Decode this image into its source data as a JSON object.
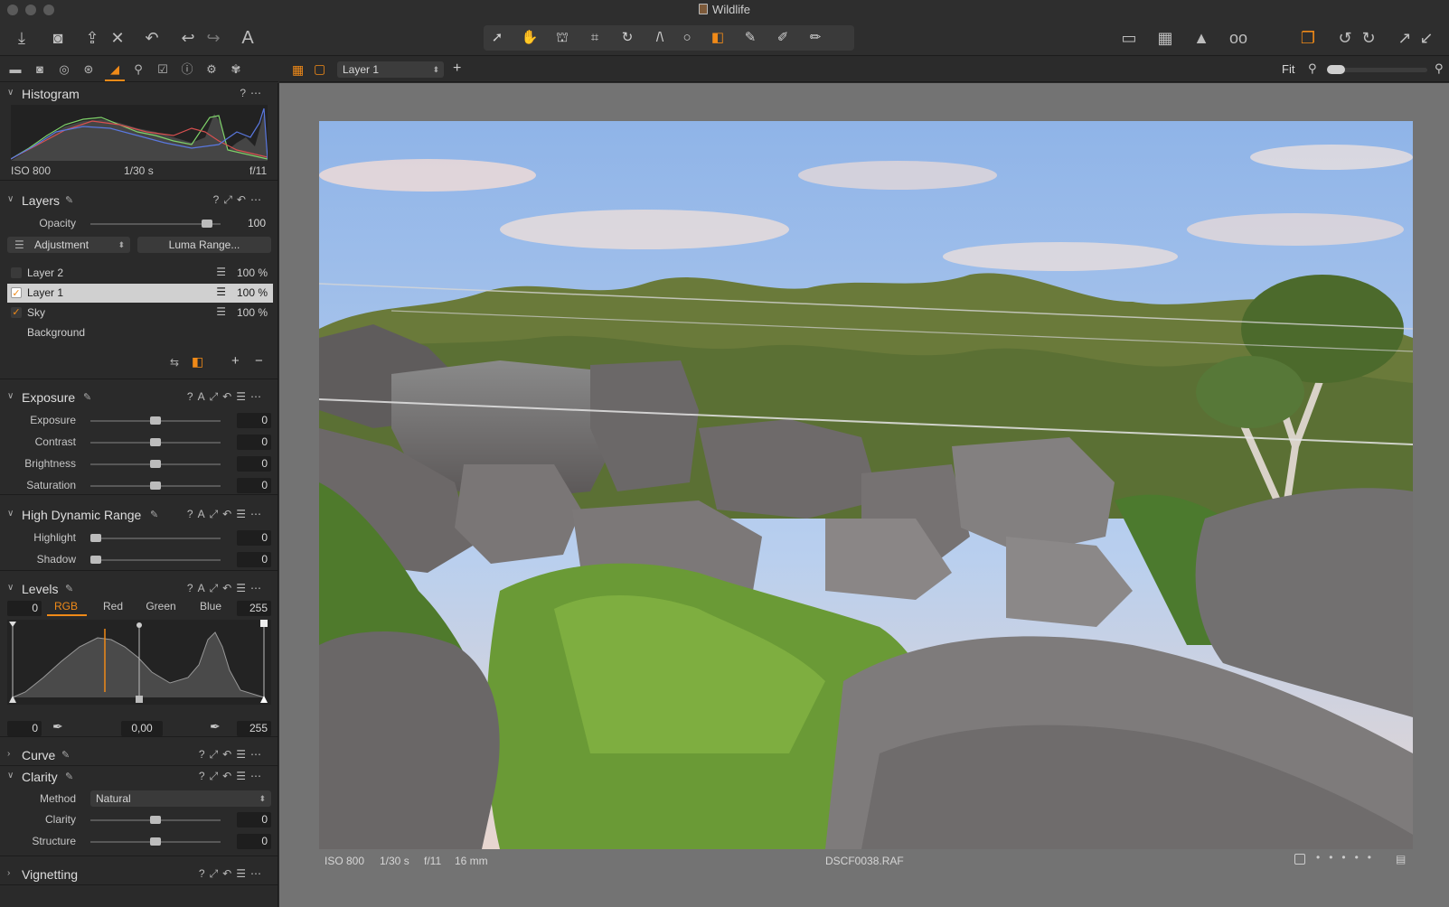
{
  "window": {
    "title": "Wildlife"
  },
  "toolbar": {
    "left_icons": [
      "import-icon",
      "camera-icon",
      "export-icon",
      "delete-icon",
      "undo-all-icon",
      "undo-icon",
      "redo-icon",
      "text-icon"
    ],
    "center_icons": [
      "cursor-icon",
      "pan-icon",
      "stamp-icon",
      "crop-icon",
      "rotate-icon",
      "keystone-icon",
      "circle-icon",
      "gradient-icon",
      "brush-icon",
      "eraser-icon",
      "draw-mask-icon"
    ],
    "right_icons": [
      "edit-mask-icon",
      "grid-icon",
      "warning-icon",
      "proof-icon",
      "variants-icon",
      "rotate-left-icon",
      "rotate-right-icon",
      "expand-icon",
      "collapse-icon"
    ]
  },
  "viewer_bar": {
    "layer_select": "Layer 1",
    "zoom_label": "Fit"
  },
  "histogram": {
    "title": "Histogram",
    "iso": "ISO 800",
    "shutter": "1/30 s",
    "aperture": "f/11"
  },
  "layers": {
    "title": "Layers",
    "opacity_label": "Opacity",
    "opacity_value": "100",
    "opacity_fraction": 0.93,
    "adjustment_label": "Adjustment",
    "luma_button": "Luma Range...",
    "items": [
      {
        "name": "Layer 2",
        "opacity": "100 %",
        "checked": false,
        "selected": false
      },
      {
        "name": "Layer 1",
        "opacity": "100 %",
        "checked": true,
        "selected": true
      },
      {
        "name": "Sky",
        "opacity": "100 %",
        "checked": true,
        "selected": false
      },
      {
        "name": "Background",
        "opacity": "",
        "checked": false,
        "selected": false
      }
    ]
  },
  "exposure": {
    "title": "Exposure",
    "rows": [
      {
        "label": "Exposure",
        "value": "0",
        "fraction": 0.5
      },
      {
        "label": "Contrast",
        "value": "0",
        "fraction": 0.5
      },
      {
        "label": "Brightness",
        "value": "0",
        "fraction": 0.5
      },
      {
        "label": "Saturation",
        "value": "0",
        "fraction": 0.5
      }
    ]
  },
  "hdr": {
    "title": "High Dynamic Range",
    "rows": [
      {
        "label": "Highlight",
        "value": "0",
        "fraction": 0.0
      },
      {
        "label": "Shadow",
        "value": "0",
        "fraction": 0.0
      }
    ]
  },
  "levels": {
    "title": "Levels",
    "low_input": "0",
    "high_input": "255",
    "tabs": [
      "RGB",
      "Red",
      "Green",
      "Blue"
    ],
    "active_tab": "RGB",
    "low_output": "0",
    "midpoint": "0,00",
    "high_output": "255"
  },
  "curve": {
    "title": "Curve"
  },
  "clarity": {
    "title": "Clarity",
    "method_label": "Method",
    "method_value": "Natural",
    "rows": [
      {
        "label": "Clarity",
        "value": "0",
        "fraction": 0.5
      },
      {
        "label": "Structure",
        "value": "0",
        "fraction": 0.5
      }
    ]
  },
  "vignetting": {
    "title": "Vignetting"
  },
  "photo_caption": {
    "iso": "ISO 800",
    "shutter": "1/30 s",
    "aperture": "f/11",
    "focal": "16 mm",
    "filename": "DSCF0038.RAF"
  },
  "colors": {
    "accent": "#f08a18",
    "panel": "#2a2a2a",
    "viewer": "#737373"
  }
}
